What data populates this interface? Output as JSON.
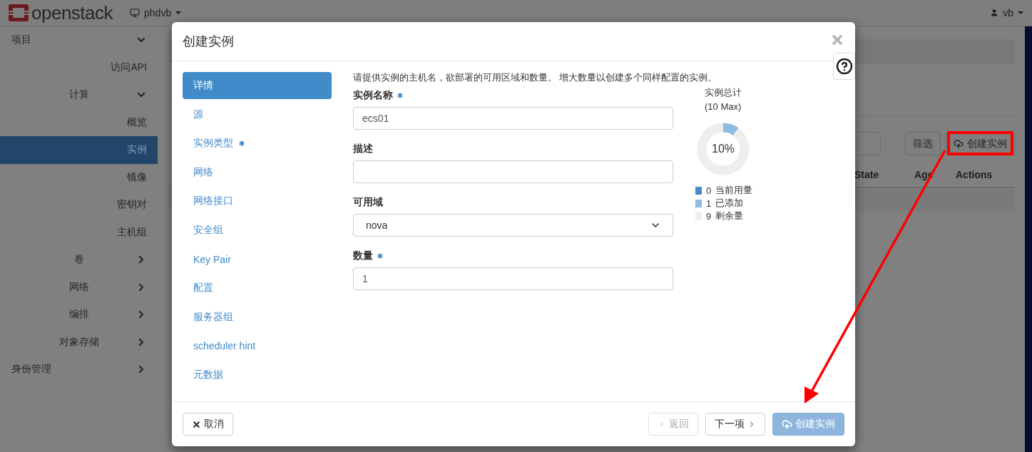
{
  "topbar": {
    "logo": "openstack",
    "project": "phdvb",
    "user": "vb"
  },
  "sidebar": {
    "items": [
      {
        "label": "项目",
        "kind": "section",
        "expanded": true,
        "children": [
          {
            "label": "访问API",
            "kind": "link",
            "selected": false
          },
          {
            "label": "计算",
            "kind": "group",
            "expanded": true,
            "children": [
              {
                "label": "概览",
                "kind": "link",
                "selected": false
              },
              {
                "label": "实例",
                "kind": "link",
                "selected": true
              },
              {
                "label": "镜像",
                "kind": "link",
                "selected": false
              },
              {
                "label": "密钥对",
                "kind": "link",
                "selected": false
              },
              {
                "label": "主机组",
                "kind": "link",
                "selected": false
              }
            ]
          },
          {
            "label": "卷",
            "kind": "group",
            "expanded": false
          },
          {
            "label": "网络",
            "kind": "group",
            "expanded": false
          },
          {
            "label": "编排",
            "kind": "group",
            "expanded": false
          },
          {
            "label": "对象存储",
            "kind": "group",
            "expanded": false
          }
        ]
      },
      {
        "label": "身份管理",
        "kind": "section",
        "expanded": false
      }
    ]
  },
  "toolbar": {
    "filter_button": "筛选",
    "create_button": "创建实例"
  },
  "table": {
    "columns": [
      "State",
      "Age",
      "Actions"
    ]
  },
  "modal": {
    "title": "创建实例",
    "steps": [
      {
        "label": "详情",
        "required": false,
        "selected": true
      },
      {
        "label": "源",
        "required": false,
        "selected": false
      },
      {
        "label": "实例类型",
        "required": true,
        "selected": false
      },
      {
        "label": "网络",
        "required": false,
        "selected": false
      },
      {
        "label": "网络接口",
        "required": false,
        "selected": false
      },
      {
        "label": "安全组",
        "required": false,
        "selected": false
      },
      {
        "label": "Key Pair",
        "required": false,
        "selected": false
      },
      {
        "label": "配置",
        "required": false,
        "selected": false
      },
      {
        "label": "服务器组",
        "required": false,
        "selected": false
      },
      {
        "label": "scheduler hint",
        "required": false,
        "selected": false
      },
      {
        "label": "元数据",
        "required": false,
        "selected": false
      }
    ],
    "description": "请提供实例的主机名，欲部署的可用区域和数量。 增大数量以创建多个同样配置的实例。",
    "fields": [
      {
        "label": "实例名称",
        "required": true,
        "kind": "text",
        "value": "ecs01"
      },
      {
        "label": "描述",
        "required": false,
        "kind": "text"
      },
      {
        "label": "可用域",
        "required": false,
        "kind": "select",
        "value": "nova"
      },
      {
        "label": "数量",
        "required": true,
        "kind": "text",
        "value": "1"
      }
    ],
    "summary": {
      "title": "实例总计",
      "subtitle": "(10 Max)",
      "percent": "10%",
      "chart_data": {
        "type": "donut",
        "categories": [
          "当前用量",
          "已添加",
          "剩余量"
        ],
        "values": [
          0,
          10,
          90
        ]
      },
      "legend": [
        {
          "count": "0",
          "color": "#4589c9"
        },
        {
          "count": "1",
          "color": "#8fbbe3"
        },
        {
          "count": "9",
          "color": "#eeeeee"
        }
      ]
    },
    "buttons": [
      {
        "label": "取消",
        "kind": "cancel",
        "disabled": false
      },
      {
        "label": "返回",
        "kind": "back",
        "disabled": true
      },
      {
        "label": "下一项",
        "kind": "next",
        "disabled": false
      },
      {
        "label": "创建实例",
        "kind": "submit",
        "disabled": true
      }
    ]
  }
}
